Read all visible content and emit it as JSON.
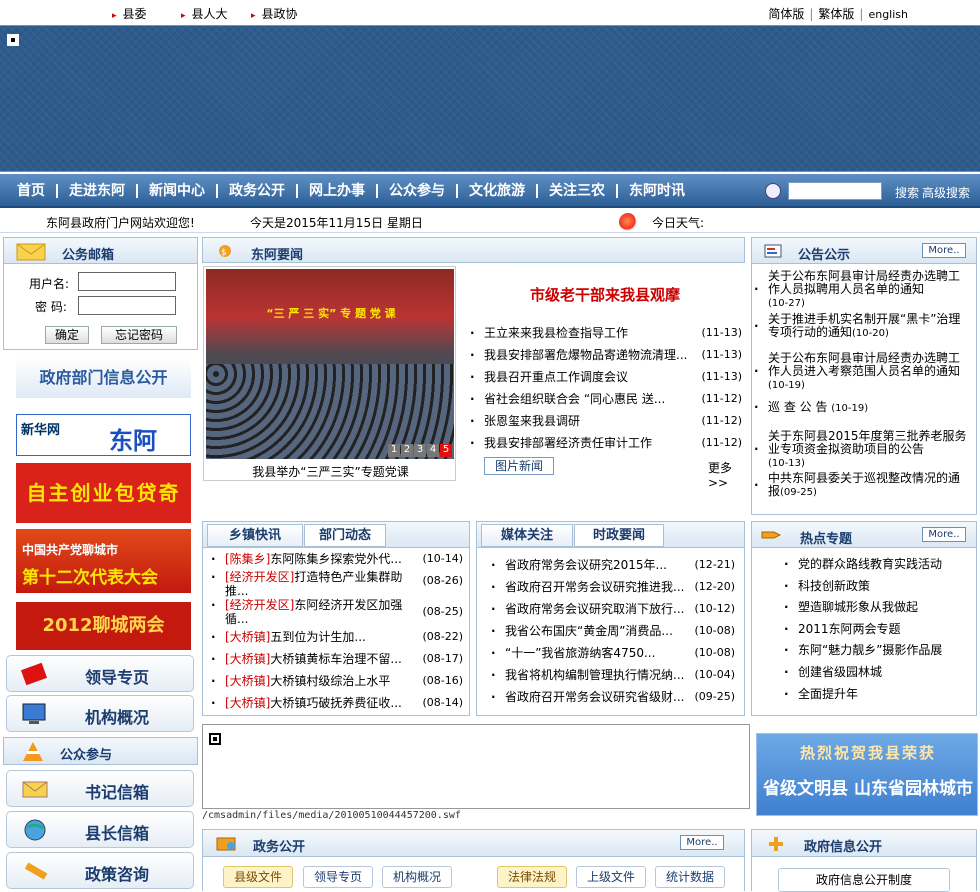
{
  "top_links": {
    "left": [
      "县委",
      "县人大",
      "县政协"
    ],
    "right": [
      "简体版",
      "繁体版",
      "english"
    ]
  },
  "nav": {
    "items": [
      "首页",
      "走进东阿",
      "新闻中心",
      "政务公开",
      "网上办事",
      "公众参与",
      "文化旅游",
      "关注三农",
      "东阿时讯"
    ],
    "search_btn": "搜索",
    "advanced_btn": "高级搜索"
  },
  "welcome": {
    "text": "东阿县政府门户网站欢迎您!",
    "date": "今天是2015年11月15日  星期日",
    "weather": "今日天气:"
  },
  "mail": {
    "title": "公务邮箱",
    "user_label": "用户名:",
    "pwd_label": "密  码:",
    "ok": "确定",
    "forget": "忘记密码"
  },
  "left_ads": [
    "政府部门信息公开",
    "新华网",
    "东阿",
    "自主创业包贷奇迹",
    "中国共产党聊城市",
    "第十二次代表大会",
    "2012聊城两会"
  ],
  "left_links": {
    "leader": "领导专页",
    "org": "机构概况",
    "public_title": "公众参与",
    "secretary": "书记信箱",
    "mayor": "县长信箱",
    "policy": "政策咨询"
  },
  "news": {
    "title": "东阿要闻",
    "photo_banner": "“三 严 三 实” 专 题 党 课",
    "photo_caption": "我县举办“三严三实”专题党课",
    "pages": [
      "1",
      "2",
      "3",
      "4",
      "5"
    ],
    "headline": "市级老干部来我县观摩",
    "items": [
      {
        "t": "王立来来我县检查指导工作",
        "d": "(11-13)"
      },
      {
        "t": "我县安排部署危爆物品寄递物流清理...",
        "d": "(11-13)"
      },
      {
        "t": "我县召开重点工作调度会议",
        "d": "(11-13)"
      },
      {
        "t": "省社会组织联合会 “同心惠民 送...",
        "d": "(11-12)"
      },
      {
        "t": "张恩玺来我县调研",
        "d": "(11-12)"
      },
      {
        "t": "我县安排部署经济责任审计工作",
        "d": "(11-12)"
      }
    ],
    "photo_btn": "图片新闻",
    "more": "更多>>"
  },
  "notice": {
    "title": "公告公示",
    "more": "More..",
    "items": [
      {
        "t": "关于公布东阿县审计局经责办选聘工作人员拟聘用人员名单的通知",
        "d": "(10-27)"
      },
      {
        "t": "关于推进手机实名制开展“黑卡”治理专项行动的通知",
        "d": "(10-20)"
      },
      {
        "t": "关于公布东阿县审计局经责办选聘工作人员进入考察范围人员名单的通知",
        "d": "(10-19)"
      },
      {
        "t": "巡 查 公 告",
        "d": "(10-19)"
      },
      {
        "t": "关于东阿县2015年度第三批养老服务业专项资金拟资助项目的公告",
        "d": "(10-13)"
      },
      {
        "t": "中共东阿县委关于巡视整改情况的通报",
        "d": "(09-25)"
      }
    ]
  },
  "town": {
    "tabs": [
      "乡镇快讯",
      "部门动态"
    ],
    "items": [
      {
        "tag": "[陈集乡]",
        "t": "东阿陈集乡探索党外代...",
        "d": "(10-14)"
      },
      {
        "tag": "[经济开发区]",
        "t": "打造特色产业集群助推...",
        "d": "(08-26)"
      },
      {
        "tag": "[经济开发区]",
        "t": "东阿经济开发区加强循...",
        "d": "(08-25)"
      },
      {
        "tag": "[大桥镇]",
        "t": "五到位为计生加...",
        "d": "(08-22)"
      },
      {
        "tag": "[大桥镇]",
        "t": "大桥镇黄标车治理不留...",
        "d": "(08-17)"
      },
      {
        "tag": "[大桥镇]",
        "t": "大桥镇村级综治上水平",
        "d": "(08-16)"
      },
      {
        "tag": "[大桥镇]",
        "t": "大桥镇巧破抚养费征收...",
        "d": "(08-14)"
      }
    ]
  },
  "media": {
    "tabs": [
      "媒体关注",
      "时政要闻"
    ],
    "items": [
      {
        "t": "省政府常务会议研究2015年...",
        "d": "(12-21)"
      },
      {
        "t": "省政府召开常务会议研究推进我...",
        "d": "(12-20)"
      },
      {
        "t": "省政府常务会议研究取消下放行...",
        "d": "(10-12)"
      },
      {
        "t": "我省公布国庆“黄金周”消费品...",
        "d": "(10-08)"
      },
      {
        "t": "“十一”我省旅游纳客4750...",
        "d": "(10-08)"
      },
      {
        "t": "我省将机构编制管理执行情况纳...",
        "d": "(10-04)"
      },
      {
        "t": "省政府召开常务会议研究省级财...",
        "d": "(09-25)"
      }
    ]
  },
  "hot": {
    "title": "热点专题",
    "more": "More..",
    "items": [
      "党的群众路线教育实践活动",
      "科技创新政策",
      "塑造聊城形象从我做起",
      "2011东阿两会专题",
      "东阿“魅力靓乡”摄影作品展",
      "创建省级园林城",
      "全面提升年"
    ]
  },
  "congrats": {
    "line1": "热烈祝贺我县荣获",
    "line2": "省级文明县 山东省园林城市"
  },
  "flash_path": "/cmsadmin/files/media/20100510044457200.swf",
  "gov": {
    "title": "政务公开",
    "more": "More..",
    "tabs": [
      "县级文件",
      "领导专页",
      "机构概况",
      "法律法规",
      "上级文件",
      "统计数据"
    ]
  },
  "govinfo": {
    "title": "政府信息公开",
    "sub": "政府信息公开制度"
  }
}
